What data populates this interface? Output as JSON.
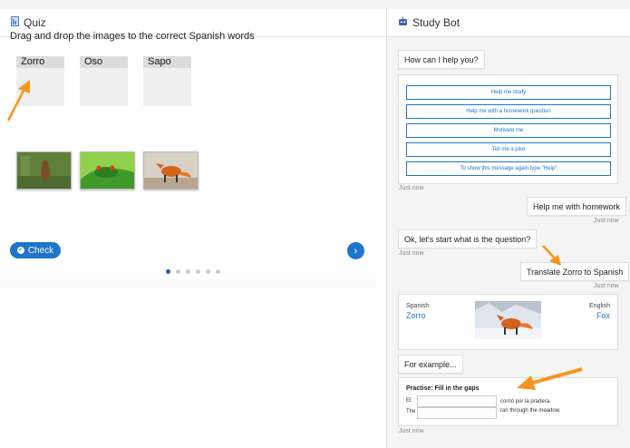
{
  "quiz": {
    "title": "Quiz",
    "instruction": "Drag and drop the images to the correct Spanish words",
    "drop_targets": [
      "Zorro",
      "Oso",
      "Sapo"
    ],
    "images": [
      "bear-image",
      "frog-image",
      "fox-image"
    ],
    "check_label": "Check",
    "pagination": {
      "total": 6,
      "current": 1
    }
  },
  "bot": {
    "title": "Study Bot",
    "greeting": "How can I help you?",
    "menu_options": [
      "Help me study",
      "Help me with a homework question",
      "Motivate me",
      "Tell me a joke",
      "To show this message again type \"Help\""
    ],
    "time_1": "Just now",
    "user_msg_1": "Help me with homework",
    "time_2": "Just now",
    "bot_msg_2": "Ok, let's start what is the question?",
    "time_3": "Just now",
    "user_msg_2": "Translate Zorro to Spanish",
    "time_4": "Just now",
    "translation": {
      "lang_left": "Spanish",
      "word_left": "Zorro",
      "lang_right": "English",
      "word_right": "Fox"
    },
    "bot_msg_3": "For example...",
    "practice": {
      "title": "Practise: Fill in the gaps",
      "line1_prefix": "El",
      "line1_suffix": "corrió por la pradera.",
      "line2_prefix": "The",
      "line2_suffix": "ran through the meadow."
    },
    "time_5": "Just now"
  },
  "colors": {
    "accent": "#1e75c9",
    "annotation_arrow": "#f5961e"
  }
}
